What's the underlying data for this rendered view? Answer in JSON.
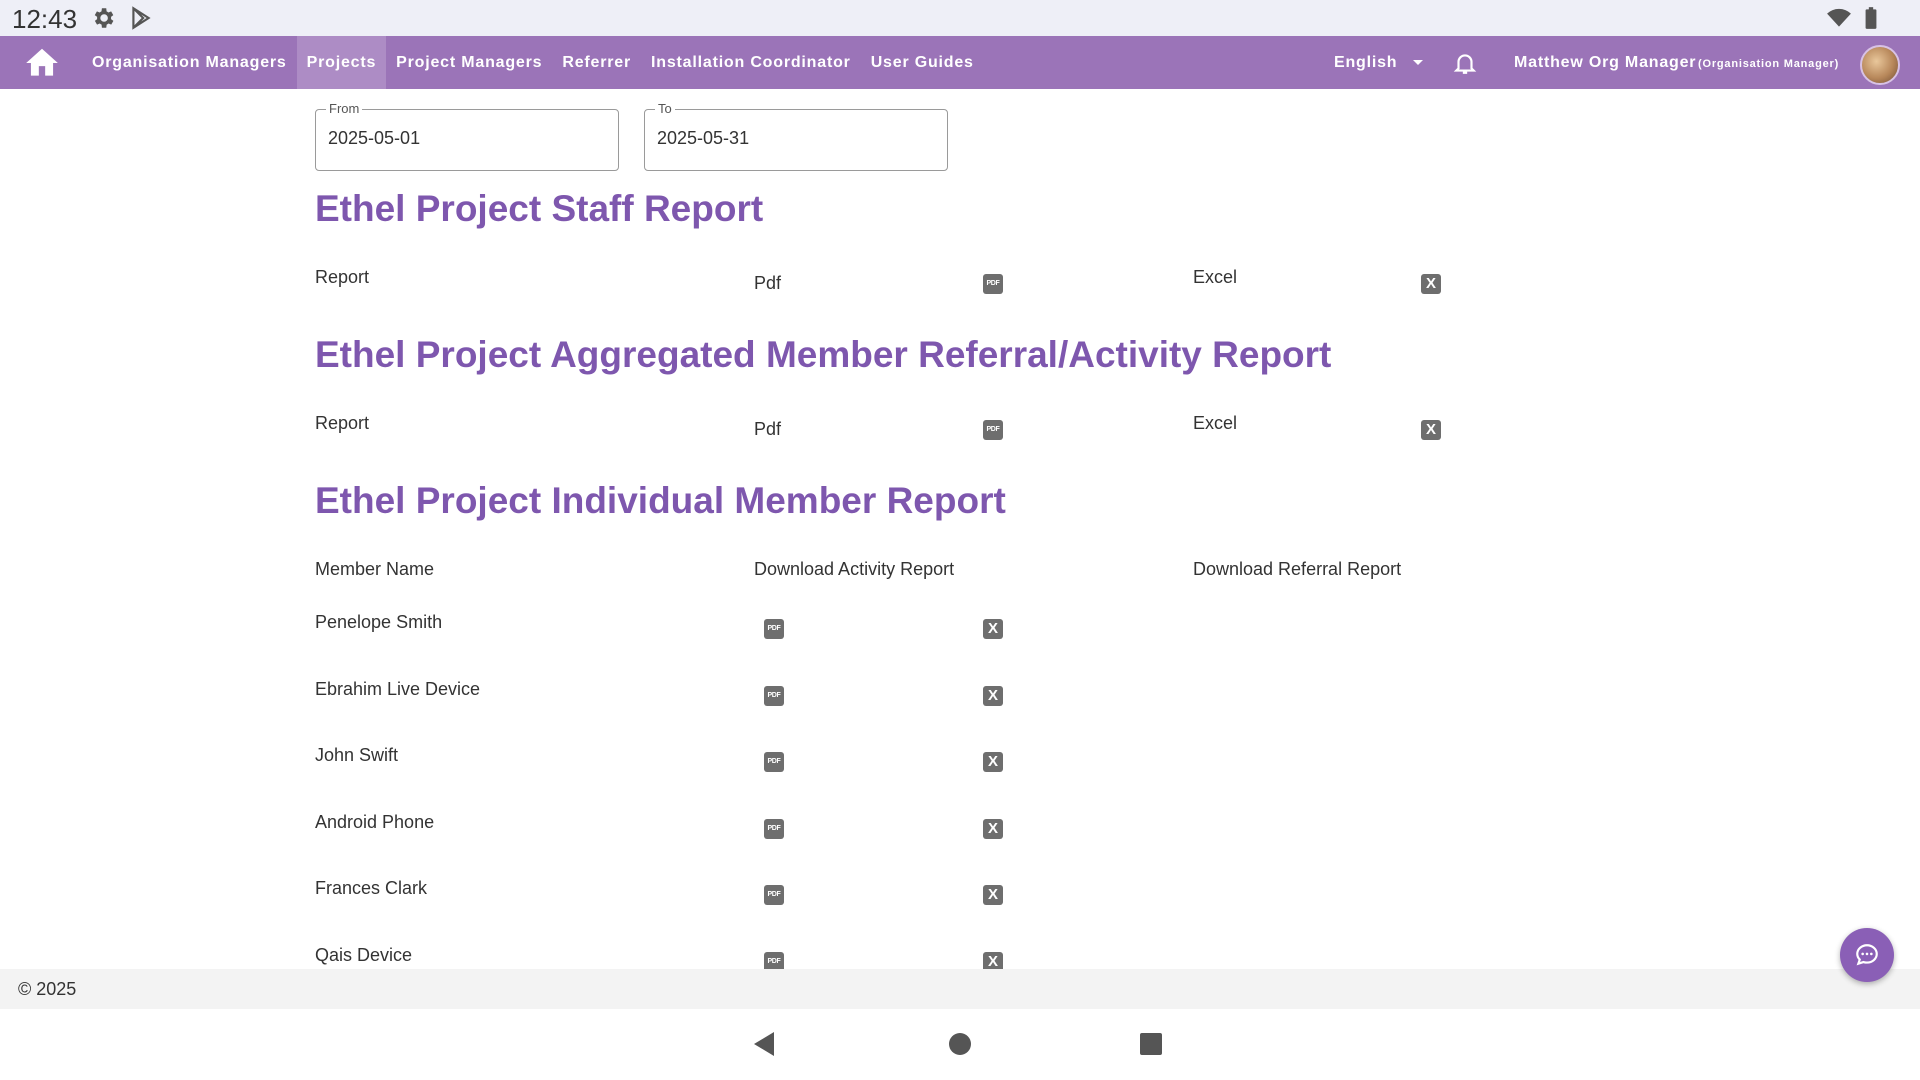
{
  "status_bar": {
    "time": "12:43"
  },
  "nav": {
    "links": [
      {
        "label": "Organisation Managers",
        "active": false
      },
      {
        "label": "Projects",
        "active": true
      },
      {
        "label": "Project Managers",
        "active": false
      },
      {
        "label": "Referrer",
        "active": false
      },
      {
        "label": "Installation Coordinator",
        "active": false
      },
      {
        "label": "User Guides",
        "active": false
      }
    ],
    "language": "English",
    "user_name": "Matthew Org Manager",
    "user_role": "(Organisation Manager)"
  },
  "filters": {
    "from_label": "From",
    "from_value": "2025-05-01",
    "to_label": "To",
    "to_value": "2025-05-31"
  },
  "staff_report": {
    "title": "Ethel Project Staff Report",
    "report_label": "Report",
    "pdf_label": "Pdf",
    "excel_label": "Excel"
  },
  "aggregated_report": {
    "title": "Ethel Project Aggregated Member Referral/Activity Report",
    "report_label": "Report",
    "pdf_label": "Pdf",
    "excel_label": "Excel"
  },
  "individual_report": {
    "title": "Ethel Project Individual Member Report",
    "headers": {
      "member_name": "Member Name",
      "activity": "Download Activity Report",
      "referral": "Download Referral Report"
    },
    "members": [
      "Penelope Smith",
      "Ebrahim Live Device",
      "John Swift",
      "Android Phone",
      "Frances Clark",
      "Qais Device"
    ]
  },
  "icons": {
    "pdf": "PDF",
    "excel": "X"
  },
  "footer": {
    "copyright": "© 2025"
  },
  "colors": {
    "nav_bg": "#9b74b8",
    "nav_active": "#ad8cc5",
    "title": "#7e57ae",
    "fab": "#8a5fb6"
  }
}
